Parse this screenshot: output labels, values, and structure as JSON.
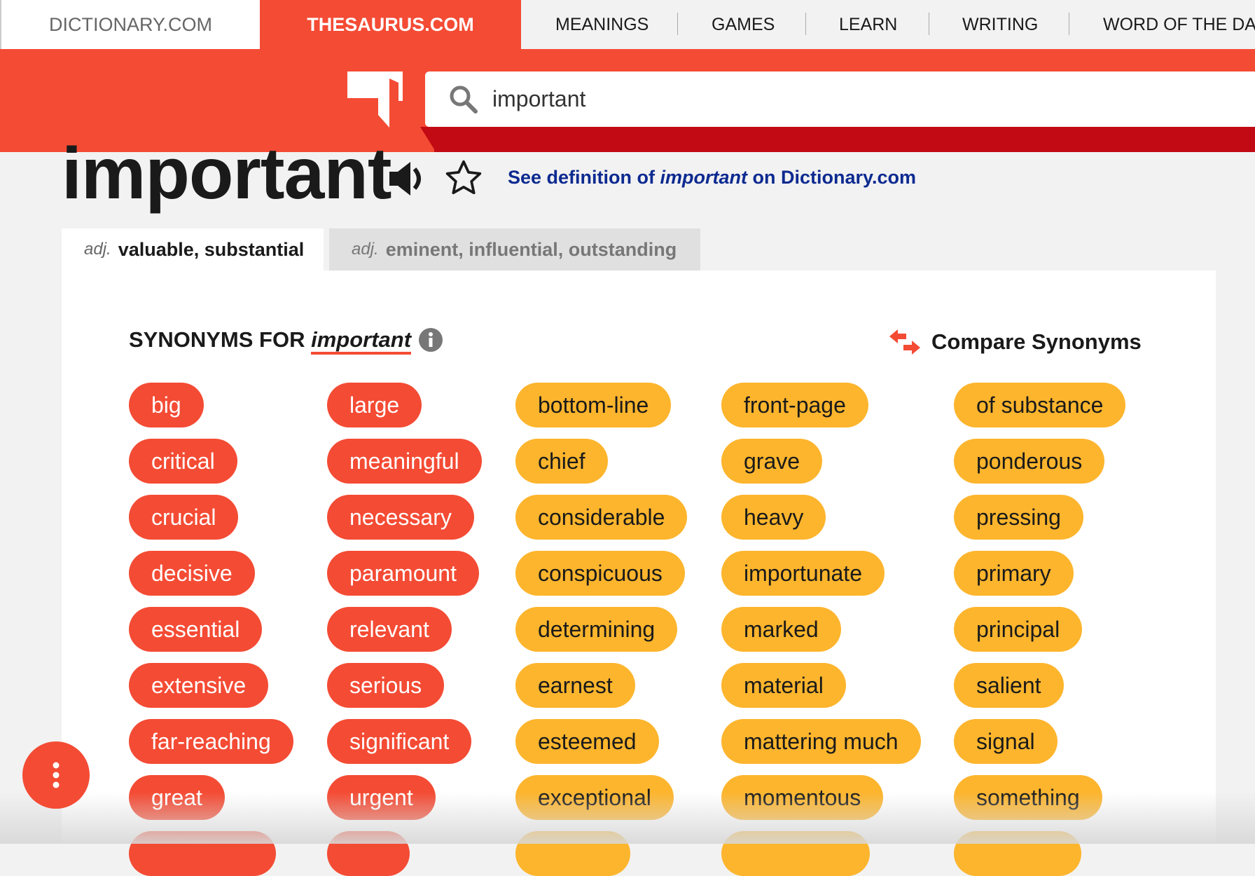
{
  "nav": {
    "dictionary": "DICTIONARY.COM",
    "thesaurus": "THESAURUS.COM",
    "items": [
      "MEANINGS",
      "GAMES",
      "LEARN",
      "WRITING",
      "WORD OF THE DAY"
    ]
  },
  "search": {
    "value": "important"
  },
  "entry": {
    "word": "important",
    "link_prefix": "See definition of ",
    "link_word": "important",
    "link_suffix": " on Dictionary.com"
  },
  "senses": [
    {
      "pos": "adj.",
      "label": "valuable, substantial",
      "active": true
    },
    {
      "pos": "adj.",
      "label": "eminent, influential, outstanding",
      "active": false
    }
  ],
  "synonyms": {
    "heading": "SYNONYMS FOR ",
    "word": "important",
    "compare_label": "Compare Synonyms",
    "columns": [
      {
        "color": "red",
        "words": [
          "big",
          "critical",
          "crucial",
          "decisive",
          "essential",
          "extensive",
          "far-reaching",
          "great",
          ""
        ]
      },
      {
        "color": "red",
        "words": [
          "large",
          "meaningful",
          "necessary",
          "paramount",
          "relevant",
          "serious",
          "significant",
          "urgent",
          ""
        ]
      },
      {
        "color": "yellow",
        "words": [
          "bottom-line",
          "chief",
          "considerable",
          "conspicuous",
          "determining",
          "earnest",
          "esteemed",
          "exceptional",
          ""
        ]
      },
      {
        "color": "yellow",
        "words": [
          "front-page",
          "grave",
          "heavy",
          "importunate",
          "marked",
          "material",
          "mattering much",
          "momentous",
          ""
        ]
      },
      {
        "color": "yellow",
        "words": [
          "of substance",
          "ponderous",
          "pressing",
          "primary",
          "principal",
          "salient",
          "signal",
          "something",
          ""
        ]
      }
    ]
  },
  "colors": {
    "brand": "#f44b34",
    "dark_red": "#c20a14",
    "strong": "#f44b34",
    "medium": "#fdb52d",
    "link": "#0d2a90"
  }
}
